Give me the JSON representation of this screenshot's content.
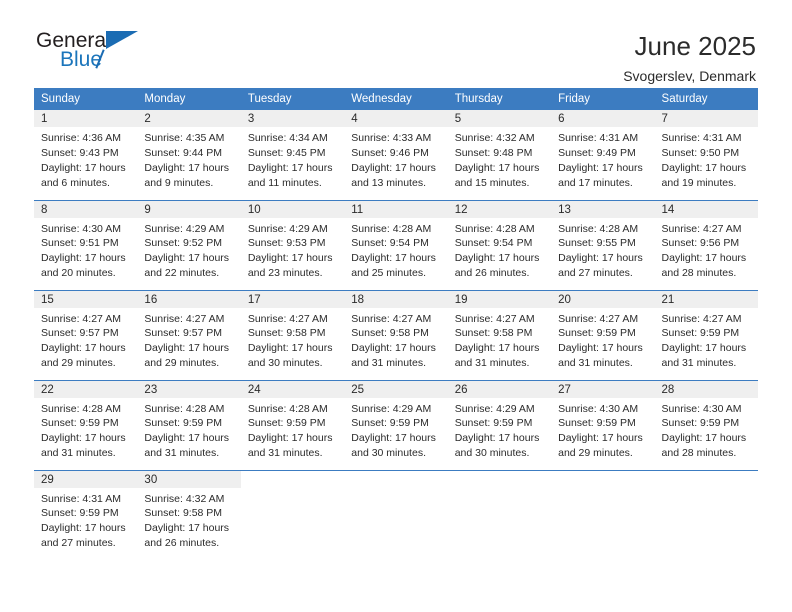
{
  "logo": {
    "word_top": "General",
    "word_bottom": "Blue",
    "triangle_color": "#1b6cb3"
  },
  "header": {
    "title": "June 2025",
    "subtitle": "Svogerslev, Denmark"
  },
  "theme": {
    "header_blue": "#3c7cc1",
    "day_band_gray": "#efefef"
  },
  "calendar": {
    "weekday_headers": [
      "Sunday",
      "Monday",
      "Tuesday",
      "Wednesday",
      "Thursday",
      "Friday",
      "Saturday"
    ],
    "labels": {
      "sunrise": "Sunrise:",
      "sunset": "Sunset:",
      "daylight": "Daylight:"
    },
    "weeks": [
      [
        {
          "day": "1",
          "sunrise": "Sunrise: 4:36 AM",
          "sunset": "Sunset: 9:43 PM",
          "daylight_line1": "Daylight: 17 hours",
          "daylight_line2": "and 6 minutes."
        },
        {
          "day": "2",
          "sunrise": "Sunrise: 4:35 AM",
          "sunset": "Sunset: 9:44 PM",
          "daylight_line1": "Daylight: 17 hours",
          "daylight_line2": "and 9 minutes."
        },
        {
          "day": "3",
          "sunrise": "Sunrise: 4:34 AM",
          "sunset": "Sunset: 9:45 PM",
          "daylight_line1": "Daylight: 17 hours",
          "daylight_line2": "and 11 minutes."
        },
        {
          "day": "4",
          "sunrise": "Sunrise: 4:33 AM",
          "sunset": "Sunset: 9:46 PM",
          "daylight_line1": "Daylight: 17 hours",
          "daylight_line2": "and 13 minutes."
        },
        {
          "day": "5",
          "sunrise": "Sunrise: 4:32 AM",
          "sunset": "Sunset: 9:48 PM",
          "daylight_line1": "Daylight: 17 hours",
          "daylight_line2": "and 15 minutes."
        },
        {
          "day": "6",
          "sunrise": "Sunrise: 4:31 AM",
          "sunset": "Sunset: 9:49 PM",
          "daylight_line1": "Daylight: 17 hours",
          "daylight_line2": "and 17 minutes."
        },
        {
          "day": "7",
          "sunrise": "Sunrise: 4:31 AM",
          "sunset": "Sunset: 9:50 PM",
          "daylight_line1": "Daylight: 17 hours",
          "daylight_line2": "and 19 minutes."
        }
      ],
      [
        {
          "day": "8",
          "sunrise": "Sunrise: 4:30 AM",
          "sunset": "Sunset: 9:51 PM",
          "daylight_line1": "Daylight: 17 hours",
          "daylight_line2": "and 20 minutes."
        },
        {
          "day": "9",
          "sunrise": "Sunrise: 4:29 AM",
          "sunset": "Sunset: 9:52 PM",
          "daylight_line1": "Daylight: 17 hours",
          "daylight_line2": "and 22 minutes."
        },
        {
          "day": "10",
          "sunrise": "Sunrise: 4:29 AM",
          "sunset": "Sunset: 9:53 PM",
          "daylight_line1": "Daylight: 17 hours",
          "daylight_line2": "and 23 minutes."
        },
        {
          "day": "11",
          "sunrise": "Sunrise: 4:28 AM",
          "sunset": "Sunset: 9:54 PM",
          "daylight_line1": "Daylight: 17 hours",
          "daylight_line2": "and 25 minutes."
        },
        {
          "day": "12",
          "sunrise": "Sunrise: 4:28 AM",
          "sunset": "Sunset: 9:54 PM",
          "daylight_line1": "Daylight: 17 hours",
          "daylight_line2": "and 26 minutes."
        },
        {
          "day": "13",
          "sunrise": "Sunrise: 4:28 AM",
          "sunset": "Sunset: 9:55 PM",
          "daylight_line1": "Daylight: 17 hours",
          "daylight_line2": "and 27 minutes."
        },
        {
          "day": "14",
          "sunrise": "Sunrise: 4:27 AM",
          "sunset": "Sunset: 9:56 PM",
          "daylight_line1": "Daylight: 17 hours",
          "daylight_line2": "and 28 minutes."
        }
      ],
      [
        {
          "day": "15",
          "sunrise": "Sunrise: 4:27 AM",
          "sunset": "Sunset: 9:57 PM",
          "daylight_line1": "Daylight: 17 hours",
          "daylight_line2": "and 29 minutes."
        },
        {
          "day": "16",
          "sunrise": "Sunrise: 4:27 AM",
          "sunset": "Sunset: 9:57 PM",
          "daylight_line1": "Daylight: 17 hours",
          "daylight_line2": "and 29 minutes."
        },
        {
          "day": "17",
          "sunrise": "Sunrise: 4:27 AM",
          "sunset": "Sunset: 9:58 PM",
          "daylight_line1": "Daylight: 17 hours",
          "daylight_line2": "and 30 minutes."
        },
        {
          "day": "18",
          "sunrise": "Sunrise: 4:27 AM",
          "sunset": "Sunset: 9:58 PM",
          "daylight_line1": "Daylight: 17 hours",
          "daylight_line2": "and 31 minutes."
        },
        {
          "day": "19",
          "sunrise": "Sunrise: 4:27 AM",
          "sunset": "Sunset: 9:58 PM",
          "daylight_line1": "Daylight: 17 hours",
          "daylight_line2": "and 31 minutes."
        },
        {
          "day": "20",
          "sunrise": "Sunrise: 4:27 AM",
          "sunset": "Sunset: 9:59 PM",
          "daylight_line1": "Daylight: 17 hours",
          "daylight_line2": "and 31 minutes."
        },
        {
          "day": "21",
          "sunrise": "Sunrise: 4:27 AM",
          "sunset": "Sunset: 9:59 PM",
          "daylight_line1": "Daylight: 17 hours",
          "daylight_line2": "and 31 minutes."
        }
      ],
      [
        {
          "day": "22",
          "sunrise": "Sunrise: 4:28 AM",
          "sunset": "Sunset: 9:59 PM",
          "daylight_line1": "Daylight: 17 hours",
          "daylight_line2": "and 31 minutes."
        },
        {
          "day": "23",
          "sunrise": "Sunrise: 4:28 AM",
          "sunset": "Sunset: 9:59 PM",
          "daylight_line1": "Daylight: 17 hours",
          "daylight_line2": "and 31 minutes."
        },
        {
          "day": "24",
          "sunrise": "Sunrise: 4:28 AM",
          "sunset": "Sunset: 9:59 PM",
          "daylight_line1": "Daylight: 17 hours",
          "daylight_line2": "and 31 minutes."
        },
        {
          "day": "25",
          "sunrise": "Sunrise: 4:29 AM",
          "sunset": "Sunset: 9:59 PM",
          "daylight_line1": "Daylight: 17 hours",
          "daylight_line2": "and 30 minutes."
        },
        {
          "day": "26",
          "sunrise": "Sunrise: 4:29 AM",
          "sunset": "Sunset: 9:59 PM",
          "daylight_line1": "Daylight: 17 hours",
          "daylight_line2": "and 30 minutes."
        },
        {
          "day": "27",
          "sunrise": "Sunrise: 4:30 AM",
          "sunset": "Sunset: 9:59 PM",
          "daylight_line1": "Daylight: 17 hours",
          "daylight_line2": "and 29 minutes."
        },
        {
          "day": "28",
          "sunrise": "Sunrise: 4:30 AM",
          "sunset": "Sunset: 9:59 PM",
          "daylight_line1": "Daylight: 17 hours",
          "daylight_line2": "and 28 minutes."
        }
      ],
      [
        {
          "day": "29",
          "sunrise": "Sunrise: 4:31 AM",
          "sunset": "Sunset: 9:59 PM",
          "daylight_line1": "Daylight: 17 hours",
          "daylight_line2": "and 27 minutes."
        },
        {
          "day": "30",
          "sunrise": "Sunrise: 4:32 AM",
          "sunset": "Sunset: 9:58 PM",
          "daylight_line1": "Daylight: 17 hours",
          "daylight_line2": "and 26 minutes."
        },
        {
          "day": "",
          "sunrise": "",
          "sunset": "",
          "daylight_line1": "",
          "daylight_line2": ""
        },
        {
          "day": "",
          "sunrise": "",
          "sunset": "",
          "daylight_line1": "",
          "daylight_line2": ""
        },
        {
          "day": "",
          "sunrise": "",
          "sunset": "",
          "daylight_line1": "",
          "daylight_line2": ""
        },
        {
          "day": "",
          "sunrise": "",
          "sunset": "",
          "daylight_line1": "",
          "daylight_line2": ""
        },
        {
          "day": "",
          "sunrise": "",
          "sunset": "",
          "daylight_line1": "",
          "daylight_line2": ""
        }
      ]
    ]
  }
}
